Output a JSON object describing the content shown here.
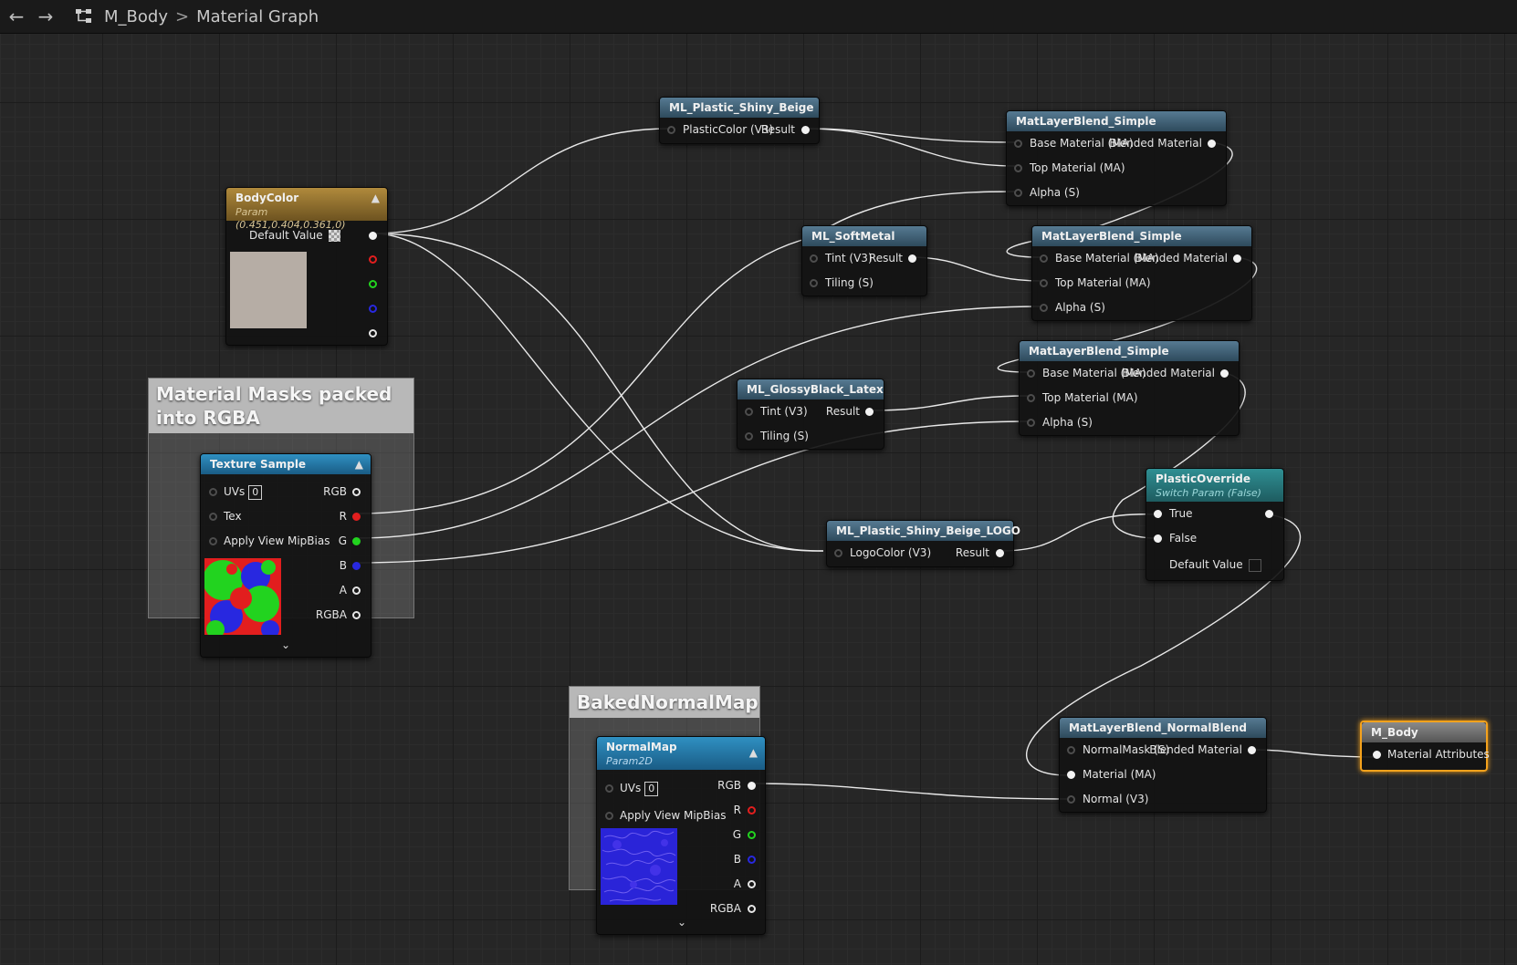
{
  "toolbar": {
    "back_icon": "arrow-left-icon",
    "forward_icon": "arrow-right-icon",
    "hierarchy_icon": "hierarchy-icon",
    "breadcrumb_root": "M_Body",
    "breadcrumb_separator": ">",
    "breadcrumb_current": "Material Graph"
  },
  "comments": {
    "masks_title": "Material Masks packed into RGBA",
    "normal_title": "BakedNormalMap"
  },
  "nodes": {
    "bodycolor": {
      "title": "BodyColor",
      "subtitle": "Param (0.451,0.404,0.361,0)",
      "default_label": "Default Value",
      "swatch_color": "#b6ada5"
    },
    "texture_sample": {
      "title": "Texture Sample",
      "uvs_label": "UVs",
      "uvs_value": "0",
      "tex_label": "Tex",
      "mip_label": "Apply View MipBias",
      "out_rgb": "RGB",
      "out_r": "R",
      "out_g": "G",
      "out_b": "B",
      "out_a": "A",
      "out_rgba": "RGBA"
    },
    "plastic_beige": {
      "title": "ML_Plastic_Shiny_Beige",
      "in": "PlasticColor (V3)",
      "out": "Result"
    },
    "softmetal": {
      "title": "ML_SoftMetal",
      "in_tint": "Tint (V3)",
      "in_tiling": "Tiling (S)",
      "out": "Result"
    },
    "glossy_latex": {
      "title": "ML_GlossyBlack_Latex",
      "in_tint": "Tint (V3)",
      "in_tiling": "Tiling (S)",
      "out": "Result"
    },
    "beige_logo": {
      "title": "ML_Plastic_Shiny_Beige_LOGO",
      "in": "LogoColor (V3)",
      "out": "Result"
    },
    "blend1": {
      "title": "MatLayerBlend_Simple",
      "in_base": "Base Material (MA)",
      "in_top": "Top Material (MA)",
      "in_alpha": "Alpha (S)",
      "out": "Blended Material"
    },
    "blend2": {
      "title": "MatLayerBlend_Simple",
      "in_base": "Base Material (MA)",
      "in_top": "Top Material (MA)",
      "in_alpha": "Alpha (S)",
      "out": "Blended Material"
    },
    "blend3": {
      "title": "MatLayerBlend_Simple",
      "in_base": "Base Material (MA)",
      "in_top": "Top Material (MA)",
      "in_alpha": "Alpha (S)",
      "out": "Blended Material"
    },
    "plastic_override": {
      "title": "PlasticOverride",
      "subtitle": "Switch Param (False)",
      "in_true": "True",
      "in_false": "False",
      "default_label": "Default Value"
    },
    "normal_blend": {
      "title": "MatLayerBlend_NormalBlend",
      "in_mask": "NormalMask (S)",
      "in_material": "Material (MA)",
      "in_normal": "Normal (V3)",
      "out": "Blended Material"
    },
    "normalmap": {
      "title": "NormalMap",
      "subtitle": "Param2D",
      "uvs_label": "UVs",
      "uvs_value": "0",
      "mip_label": "Apply View MipBias",
      "out_rgb": "RGB",
      "out_r": "R",
      "out_g": "G",
      "out_b": "B",
      "out_a": "A",
      "out_rgba": "RGBA"
    },
    "m_body": {
      "title": "M_Body",
      "in": "Material Attributes"
    }
  },
  "colors": {
    "wire": "#e8e8e8",
    "selection": "#f5a21c",
    "pin_red": "#e21e1e",
    "pin_green": "#22d31f",
    "pin_blue": "#2828e0"
  }
}
